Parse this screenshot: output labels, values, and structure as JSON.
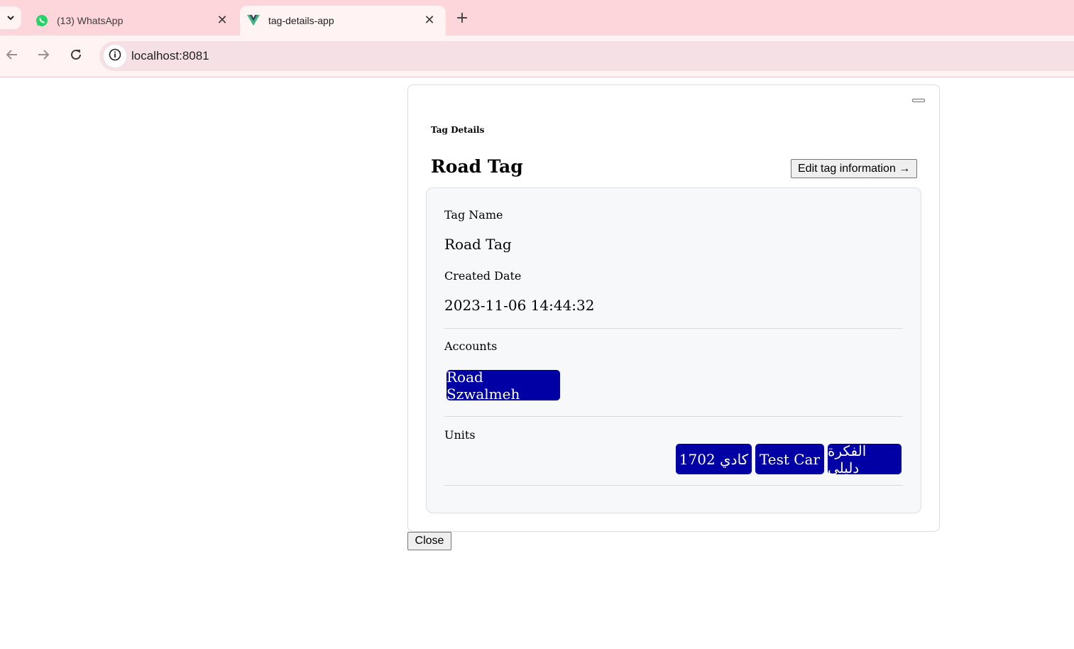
{
  "browser": {
    "tabs": [
      {
        "label": "(13) WhatsApp",
        "icon": "whatsapp-icon",
        "active": false
      },
      {
        "label": "tag-details-app",
        "icon": "vue-icon",
        "active": true
      }
    ],
    "url": "localhost:8081",
    "colors": {
      "tabstrip": "#fdd6dc",
      "toolbar": "#fff3f4"
    }
  },
  "panel": {
    "subtitle": "Tag Details",
    "title": "Road Tag",
    "edit_button": "Edit tag information →",
    "fields": {
      "tag_name_label": "Tag Name",
      "tag_name_value": "Road Tag",
      "created_label": "Created Date",
      "created_value": "2023-11-06 14:44:32"
    },
    "accounts": {
      "label": "Accounts",
      "items": [
        "Road Szwalmeh"
      ]
    },
    "units": {
      "label": "Units",
      "items": [
        "الفكرة دليلي",
        "Test Car",
        "1702 كادي"
      ]
    },
    "chip_color": "#0000a4"
  },
  "close_button": "Close"
}
